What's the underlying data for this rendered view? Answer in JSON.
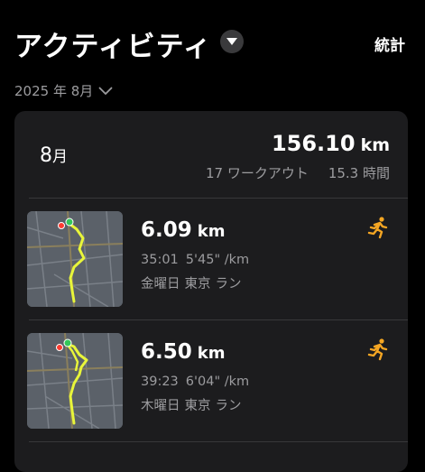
{
  "header": {
    "title": "アクティビティ",
    "stats_label": "統計",
    "period_label": "2025 年 8月"
  },
  "summary": {
    "month_num": "8",
    "month_suffix": "月",
    "total_distance": "156.10",
    "total_unit": "km",
    "workouts_text": "17 ワークアウト",
    "duration_text": "15.3 時間"
  },
  "activities": [
    {
      "distance": "6.09",
      "unit": "km",
      "duration": "35:01",
      "pace": "5'45\" /km",
      "weekday": "金曜日",
      "location": "東京",
      "type": "ラン",
      "icon": "running-icon"
    },
    {
      "distance": "6.50",
      "unit": "km",
      "duration": "39:23",
      "pace": "6'04\" /km",
      "weekday": "木曜日",
      "location": "東京",
      "type": "ラン",
      "icon": "running-icon"
    }
  ],
  "colors": {
    "background": "#000000",
    "card": "#1c1c1e",
    "secondary_text": "#9c9c9f",
    "route": "#e8f53a",
    "start_dot": "#34c759",
    "end_dot": "#ff3b30",
    "run_icon": "#f5a623"
  }
}
